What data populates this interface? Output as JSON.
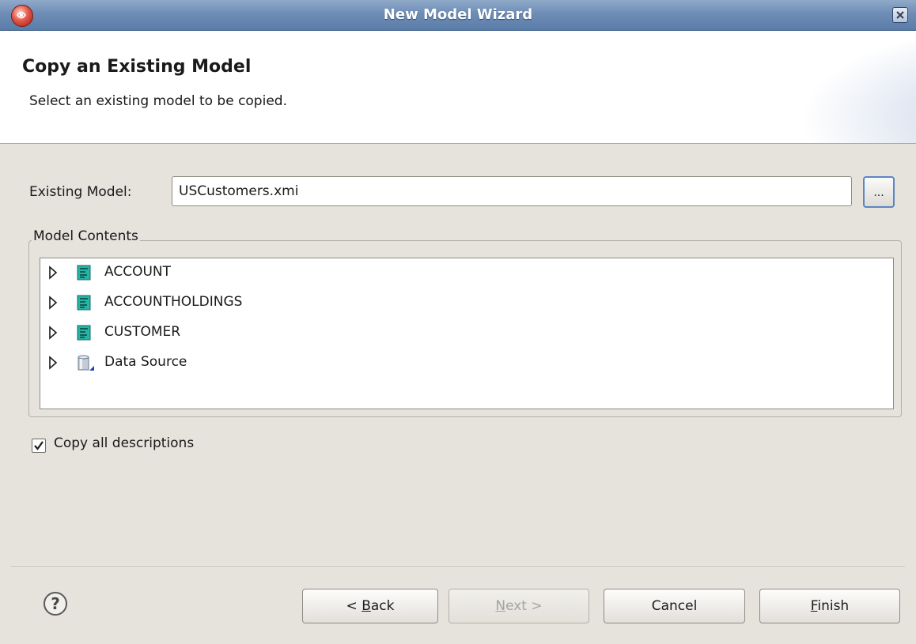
{
  "window": {
    "title": "New Model Wizard",
    "icons": {
      "app": "app-logo-icon",
      "close": "close-icon"
    }
  },
  "header": {
    "title": "Copy an Existing Model",
    "description": "Select an existing model to be copied."
  },
  "form": {
    "existing_model_label": "Existing Model:",
    "existing_model_value": "USCustomers.xmi",
    "browse_label": "..."
  },
  "model_contents": {
    "legend": "Model Contents",
    "items": [
      {
        "label": "ACCOUNT",
        "icon": "table-icon"
      },
      {
        "label": "ACCOUNTHOLDINGS",
        "icon": "table-icon"
      },
      {
        "label": "CUSTOMER",
        "icon": "table-icon"
      },
      {
        "label": "Data Source",
        "icon": "database-icon"
      }
    ]
  },
  "options": {
    "copy_descriptions_label": "Copy all descriptions",
    "copy_descriptions_checked": true
  },
  "footer": {
    "help_label": "?",
    "back": {
      "prefix": "< ",
      "mnemonic": "B",
      "rest": "ack"
    },
    "next": {
      "mnemonic": "N",
      "rest": "ext >",
      "enabled": false
    },
    "cancel": "Cancel",
    "finish": {
      "mnemonic": "F",
      "rest": "inish"
    }
  },
  "colors": {
    "titlebar": "#6e8db6",
    "background": "#e6e2dc",
    "table_icon": "#27b3a6",
    "focus_border": "#5a86c4"
  }
}
